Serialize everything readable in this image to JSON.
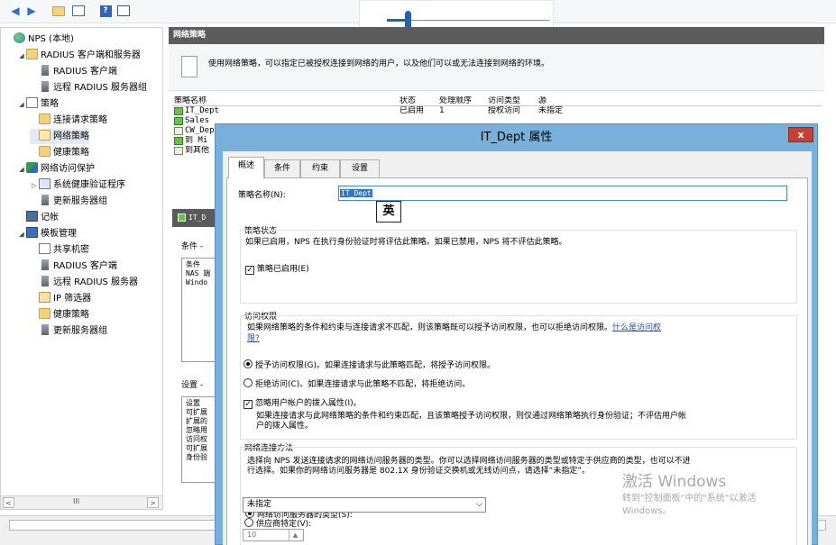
{
  "toolbar": {
    "icons": [
      "back-arrow-icon",
      "forward-arrow-icon",
      "folder-up-icon",
      "console-tree-icon",
      "help-icon",
      "panel-icon"
    ]
  },
  "slider": {
    "value_fraction": 0.13
  },
  "tree": {
    "nodes": [
      {
        "label": "NPS (本地)",
        "icon": "globe-icon",
        "depth": 0,
        "expander": ""
      },
      {
        "label": "RADIUS 客户端和服务器",
        "icon": "folder-icon",
        "depth": 1,
        "expander": "◢"
      },
      {
        "label": "RADIUS 客户端",
        "icon": "server-icon",
        "depth": 2,
        "expander": ""
      },
      {
        "label": "远程 RADIUS 服务器组",
        "icon": "server-icon",
        "depth": 2,
        "expander": ""
      },
      {
        "label": "策略",
        "icon": "doc-icon",
        "depth": 1,
        "expander": "◢"
      },
      {
        "label": "连接请求策略",
        "icon": "folder-icon",
        "depth": 2,
        "expander": ""
      },
      {
        "label": "网络策略",
        "icon": "folder-open-icon",
        "depth": 2,
        "expander": "",
        "selected": true
      },
      {
        "label": "健康策略",
        "icon": "folder-icon",
        "depth": 2,
        "expander": ""
      },
      {
        "label": "网络访问保护",
        "icon": "shield-icon",
        "depth": 1,
        "expander": "◢"
      },
      {
        "label": "系统健康验证程序",
        "icon": "chart-icon",
        "depth": 2,
        "expander": "▷"
      },
      {
        "label": "更新服务器组",
        "icon": "server-icon",
        "depth": 2,
        "expander": ""
      },
      {
        "label": "记帐",
        "icon": "book-icon",
        "depth": 1,
        "expander": ""
      },
      {
        "label": "模板管理",
        "icon": "monitor-icon",
        "depth": 1,
        "expander": "◢"
      },
      {
        "label": "共享机密",
        "icon": "doc-icon",
        "depth": 2,
        "expander": ""
      },
      {
        "label": "RADIUS 客户端",
        "icon": "server-icon",
        "depth": 2,
        "expander": ""
      },
      {
        "label": "远程 RADIUS 服务器",
        "icon": "server-icon",
        "depth": 2,
        "expander": ""
      },
      {
        "label": "IP 筛选器",
        "icon": "filter-icon",
        "depth": 2,
        "expander": ""
      },
      {
        "label": "健康策略",
        "icon": "folder-icon",
        "depth": 2,
        "expander": ""
      },
      {
        "label": "更新服务器组",
        "icon": "server-icon",
        "depth": 2,
        "expander": ""
      }
    ],
    "scroll_left": "<",
    "scroll_thumb": "III",
    "scroll_right": ">"
  },
  "main": {
    "title": "网络策略",
    "description": "使用网络策略，可以指定已被授权连接到网络的用户，以及他们可以或无法连接到网络的环境。",
    "columns": [
      "策略名称",
      "状态",
      "处理顺序",
      "访问类型",
      "源"
    ],
    "rows": [
      {
        "name": "IT_Dept",
        "status": "已启用",
        "order": "1",
        "access": "授权访问",
        "source": "未指定",
        "checked": true
      },
      {
        "name": "Sales",
        "status": "",
        "order": "",
        "access": "",
        "source": "",
        "checked": true
      },
      {
        "name": "CW_Dep",
        "status": "",
        "order": "",
        "access": "",
        "source": "",
        "checked": false
      },
      {
        "name": "到 Mi",
        "status": "",
        "order": "",
        "access": "",
        "source": "",
        "checked": true
      },
      {
        "name": "到其他",
        "status": "",
        "order": "",
        "access": "",
        "source": "",
        "checked": false
      }
    ],
    "sub_title": "IT_D",
    "conditions_label": "条件 -",
    "conditions_box": [
      "条件",
      "NAS 端",
      "Windo"
    ],
    "settings_label": "设置 -",
    "settings_box": [
      "设置",
      "可扩展",
      "扩展的",
      "忽略用",
      "访问权",
      "可扩展",
      "身份验"
    ]
  },
  "dialog": {
    "title": "IT_Dept 属性",
    "close_label": "x",
    "tabs": [
      "概述",
      "条件",
      "约束",
      "设置"
    ],
    "active_tab": 0,
    "policy_name_label": "策略名称(N):",
    "policy_name_value": "IT_Dept",
    "ime_indicator": "英",
    "state_group": "策略状态",
    "state_desc": "如果已启用，NPS 在执行身份验证时将评估此策略。如果已禁用，NPS 将不评估此策略。",
    "enabled_label": "策略已启用(E)",
    "enabled_checked": true,
    "access_group": "访问权限",
    "access_desc_1": "如果网络策略的条件和约束与连接请求不匹配，则该策略既可以授予访问权限，也可以拒绝访问权限。",
    "access_link_1": "什么是访问权",
    "access_link_2": "限?",
    "grant_label": "授予访问权限(G)。如果连接请求与此策略匹配，将授予访问权限。",
    "grant_selected": true,
    "deny_label": "拒绝访问(C)。如果连接请求与此策略不匹配，将拒绝访问。",
    "deny_selected": false,
    "ignore_label": "忽略用户帐户的拨入属性(I)。",
    "ignore_checked": true,
    "ignore_desc_1": "如果连接请求与此网络策略的条件和约束匹配，且该策略授予访问权限，则仅通过网络策略执行身份验证；不评估用户帐",
    "ignore_desc_2": "户的拨入属性。",
    "method_group": "网络连接方法",
    "method_desc_1": "选择向 NPS 发送连接请求的网络访问服务器的类型。你可以选择网络访问服务器的类型或特定于供应商的类型，也可以不进",
    "method_desc_2": "行选择。如果你的网络访问服务器是 802.1X 身份验证交换机或无线访问点，请选择“未指定”。",
    "server_type_label": "网络访问服务器的类型(S):",
    "server_type_selected": true,
    "server_type_value": "未指定",
    "vendor_label": "供应商特定(V):",
    "vendor_selected": false,
    "vendor_value": "10"
  },
  "activation": {
    "title": "激活 Windows",
    "line1": "转到\"控制面板\"中的\"系统\"以激活",
    "line2": "Windows。"
  }
}
